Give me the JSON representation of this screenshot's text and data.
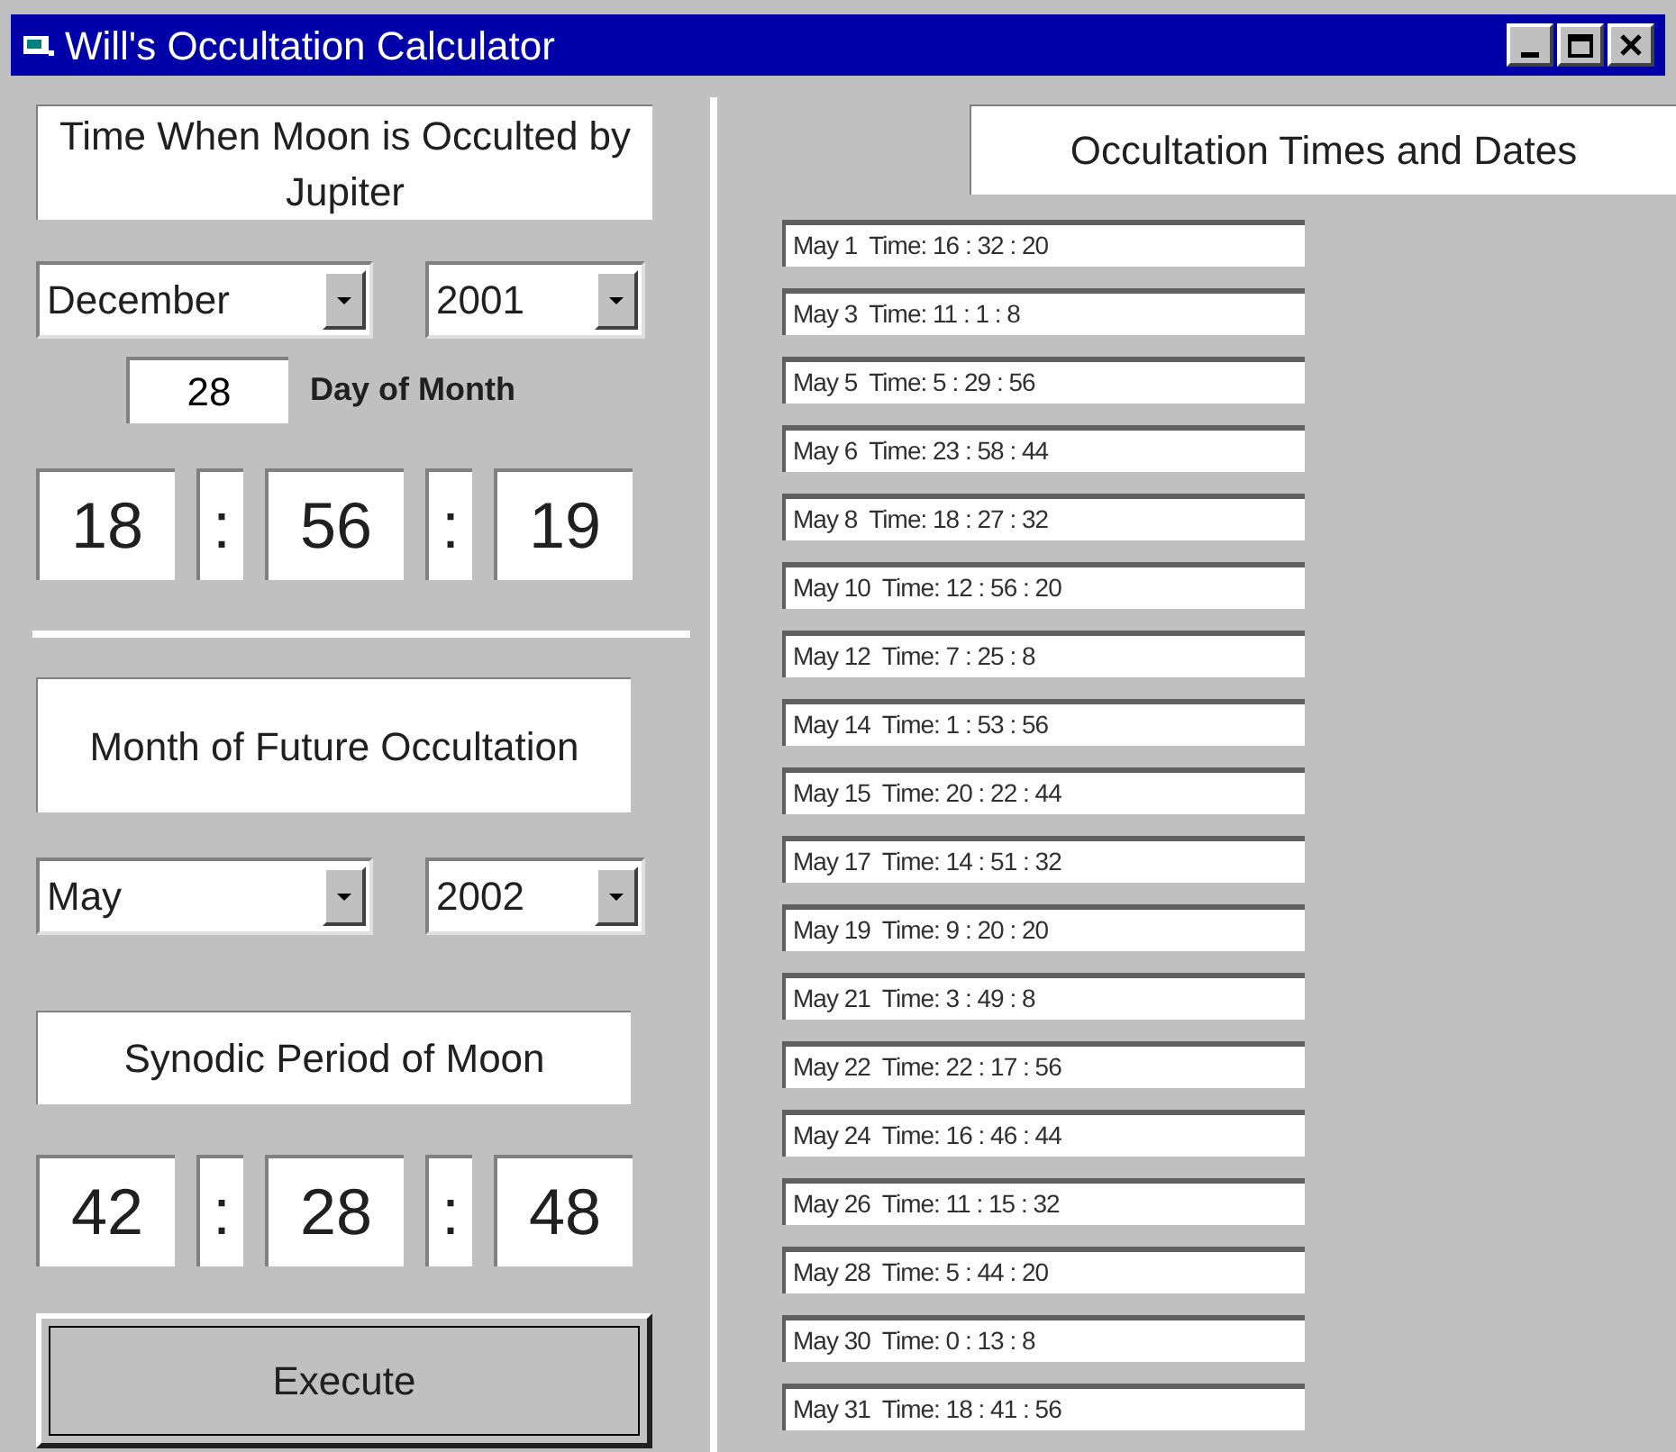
{
  "window": {
    "title": "Will's Occultation Calculator"
  },
  "known_occultation": {
    "label": "Time When Moon is Occulted by Jupiter",
    "month": "December",
    "year": "2001",
    "day": "28",
    "day_label": "Day of Month",
    "time_fields": [
      {
        "kind": "field",
        "value": "18"
      },
      {
        "kind": "separator",
        "value": ":"
      },
      {
        "kind": "field",
        "value": "56"
      },
      {
        "kind": "separator",
        "value": ":"
      },
      {
        "kind": "field",
        "value": "19"
      }
    ]
  },
  "future_occultation": {
    "label": "Month of Future Occultation",
    "month": "May",
    "year": "2002"
  },
  "synodic_period": {
    "label": "Synodic Period of Moon",
    "time_fields": [
      {
        "kind": "field",
        "value": "42"
      },
      {
        "kind": "separator",
        "value": ":"
      },
      {
        "kind": "field",
        "value": "28"
      },
      {
        "kind": "separator",
        "value": ":"
      },
      {
        "kind": "field",
        "value": "48"
      }
    ]
  },
  "execute_button": {
    "label": "Execute"
  },
  "results": {
    "heading": "Occultation Times and Dates",
    "items": [
      "May 1  Time: 16 : 32 : 20",
      "May 3  Time: 11 : 1 : 8",
      "May 5  Time: 5 : 29 : 56",
      "May 6  Time: 23 : 58 : 44",
      "May 8  Time: 18 : 27 : 32",
      "May 10  Time: 12 : 56 : 20",
      "May 12  Time: 7 : 25 : 8",
      "May 14  Time: 1 : 53 : 56",
      "May 15  Time: 20 : 22 : 44",
      "May 17  Time: 14 : 51 : 32",
      "May 19  Time: 9 : 20 : 20",
      "May 21  Time: 3 : 49 : 8",
      "May 22  Time: 22 : 17 : 56",
      "May 24  Time: 16 : 46 : 44",
      "May 26  Time: 11 : 15 : 32",
      "May 28  Time: 5 : 44 : 20",
      "May 30  Time: 0 : 13 : 8",
      "May 31  Time: 18 : 41 : 56"
    ]
  }
}
